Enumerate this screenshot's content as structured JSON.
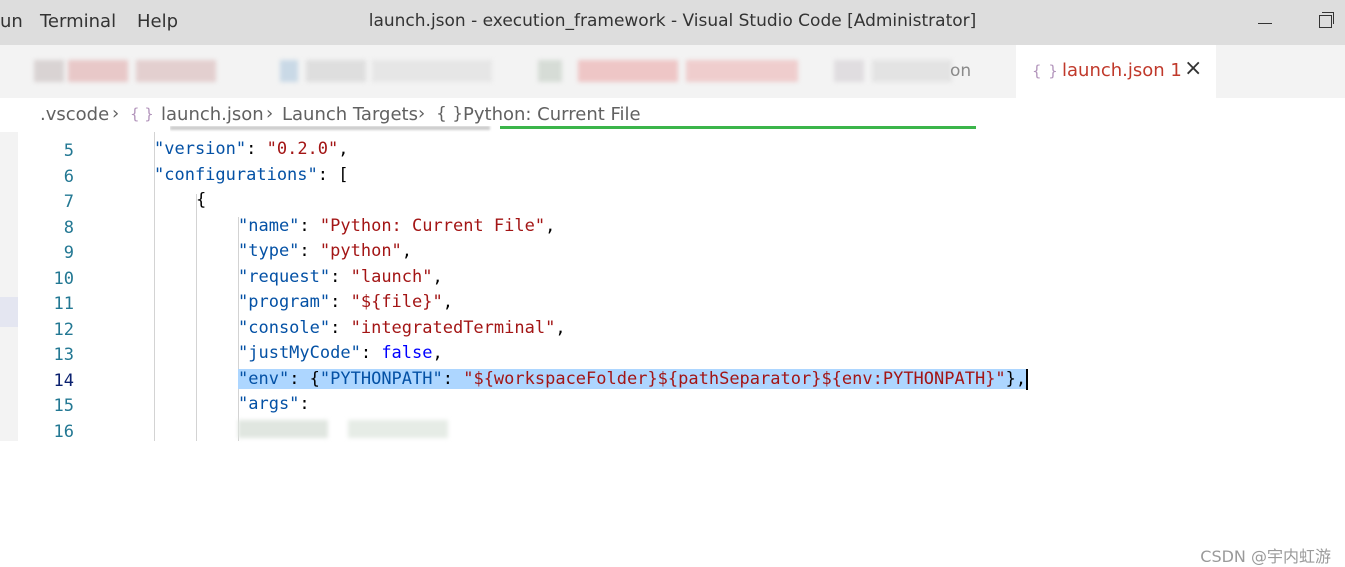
{
  "titlebar": {
    "menu": [
      "un",
      "Terminal",
      "Help"
    ],
    "title": "launch.json - execution_framework - Visual Studio Code [Administrator]"
  },
  "tabs": {
    "ghost_suffix": "on",
    "active": {
      "label": "launch.json 1",
      "icon": "json-braces-icon"
    }
  },
  "breadcrumb": {
    "items": [
      ".vscode",
      "launch.json",
      "Launch Targets",
      "Python: Current File"
    ]
  },
  "editor": {
    "lines": [
      {
        "no": "5",
        "indent": 1,
        "tokens": [
          [
            "key",
            "\"version\""
          ],
          [
            "punc",
            ": "
          ],
          [
            "str",
            "\"0.2.0\""
          ],
          [
            "punc",
            ","
          ]
        ]
      },
      {
        "no": "6",
        "indent": 1,
        "tokens": [
          [
            "key",
            "\"configurations\""
          ],
          [
            "punc",
            ": ["
          ]
        ]
      },
      {
        "no": "7",
        "indent": 2,
        "tokens": [
          [
            "punc",
            "{"
          ]
        ]
      },
      {
        "no": "8",
        "indent": 3,
        "tokens": [
          [
            "key",
            "\"name\""
          ],
          [
            "punc",
            ": "
          ],
          [
            "str",
            "\"Python: Current File\""
          ],
          [
            "punc",
            ","
          ]
        ]
      },
      {
        "no": "9",
        "indent": 3,
        "tokens": [
          [
            "key",
            "\"type\""
          ],
          [
            "punc",
            ": "
          ],
          [
            "str",
            "\"python\""
          ],
          [
            "punc",
            ","
          ]
        ]
      },
      {
        "no": "10",
        "indent": 3,
        "tokens": [
          [
            "key",
            "\"request\""
          ],
          [
            "punc",
            ": "
          ],
          [
            "str",
            "\"launch\""
          ],
          [
            "punc",
            ","
          ]
        ]
      },
      {
        "no": "11",
        "indent": 3,
        "tokens": [
          [
            "key",
            "\"program\""
          ],
          [
            "punc",
            ": "
          ],
          [
            "str",
            "\"${file}\""
          ],
          [
            "punc",
            ","
          ]
        ]
      },
      {
        "no": "12",
        "indent": 3,
        "tokens": [
          [
            "key",
            "\"console\""
          ],
          [
            "punc",
            ": "
          ],
          [
            "str",
            "\"integratedTerminal\""
          ],
          [
            "punc",
            ","
          ]
        ]
      },
      {
        "no": "13",
        "indent": 3,
        "tokens": [
          [
            "key",
            "\"justMyCode\""
          ],
          [
            "punc",
            ": "
          ],
          [
            "kw",
            "false"
          ],
          [
            "punc",
            ","
          ]
        ]
      },
      {
        "no": "14",
        "indent": 3,
        "active": true,
        "selected": true,
        "tokens": [
          [
            "key",
            "\"env\""
          ],
          [
            "punc",
            ": {"
          ],
          [
            "key",
            "\"PYTHONPATH\""
          ],
          [
            "punc",
            ": "
          ],
          [
            "str",
            "\"${workspaceFolder}${pathSeparator}${env:PYTHONPATH}\""
          ],
          [
            "punc",
            "},"
          ]
        ]
      },
      {
        "no": "15",
        "indent": 3,
        "tokens": [
          [
            "key",
            "\"args\""
          ],
          [
            "punc",
            ":"
          ]
        ]
      },
      {
        "no": "16",
        "indent": 3,
        "tokens": []
      }
    ]
  },
  "watermark": "CSDN @宇内虹游",
  "colors": {
    "key": "#0451a5",
    "string": "#a31515",
    "keyword": "#0000ff",
    "line_number": "#237893",
    "selection": "#add6ff",
    "active_tab_text": "#c0392b"
  }
}
